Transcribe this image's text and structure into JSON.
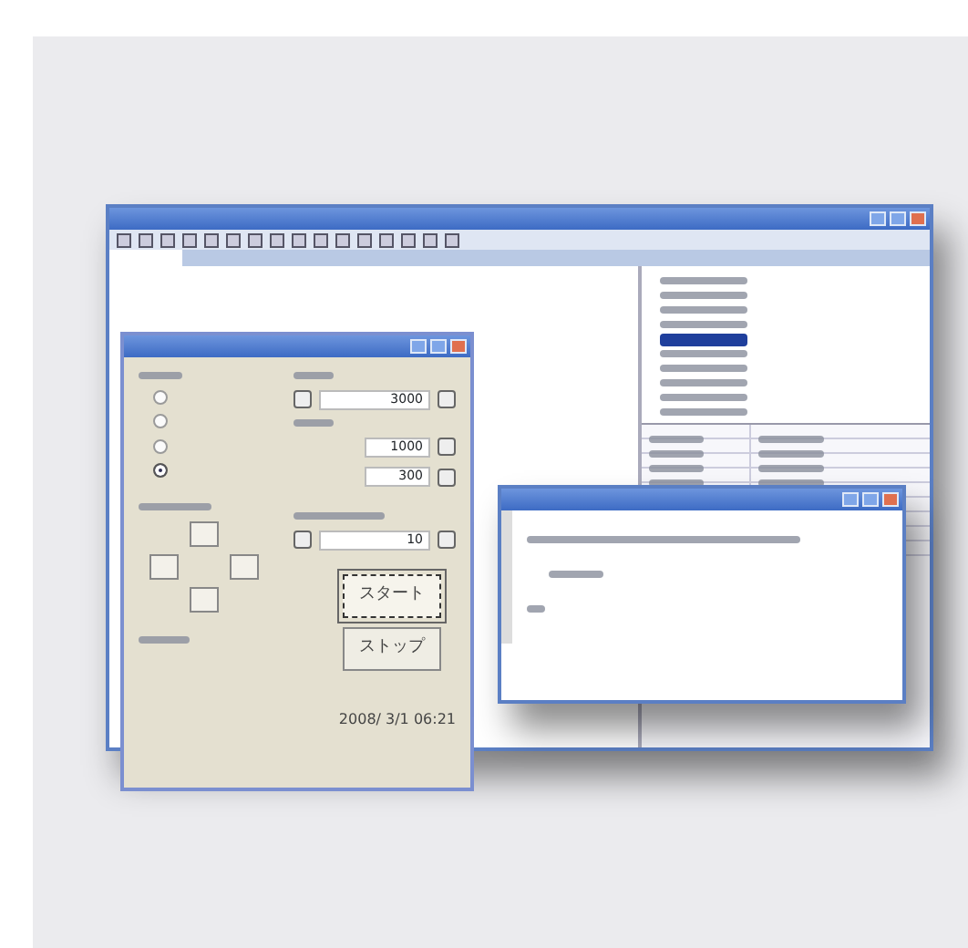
{
  "form_window": {
    "radios": [
      {
        "selected": false
      },
      {
        "selected": false
      },
      {
        "selected": false
      },
      {
        "selected": true
      }
    ],
    "spinner_top": {
      "value": "3000"
    },
    "fields": [
      {
        "value": "1000"
      },
      {
        "value": "300"
      }
    ],
    "spinner_bottom": {
      "value": "10"
    },
    "buttons": [
      {
        "label": "スタート",
        "selected": true
      },
      {
        "label": "ストップ",
        "selected": false
      }
    ],
    "timestamp": "2008/ 3/1  06:21"
  },
  "tree": {
    "items": [
      {
        "selected": false
      },
      {
        "selected": false
      },
      {
        "selected": false
      },
      {
        "selected": false
      },
      {
        "selected": true
      },
      {
        "selected": false
      },
      {
        "selected": false
      },
      {
        "selected": false
      },
      {
        "selected": false
      },
      {
        "selected": false
      }
    ]
  }
}
